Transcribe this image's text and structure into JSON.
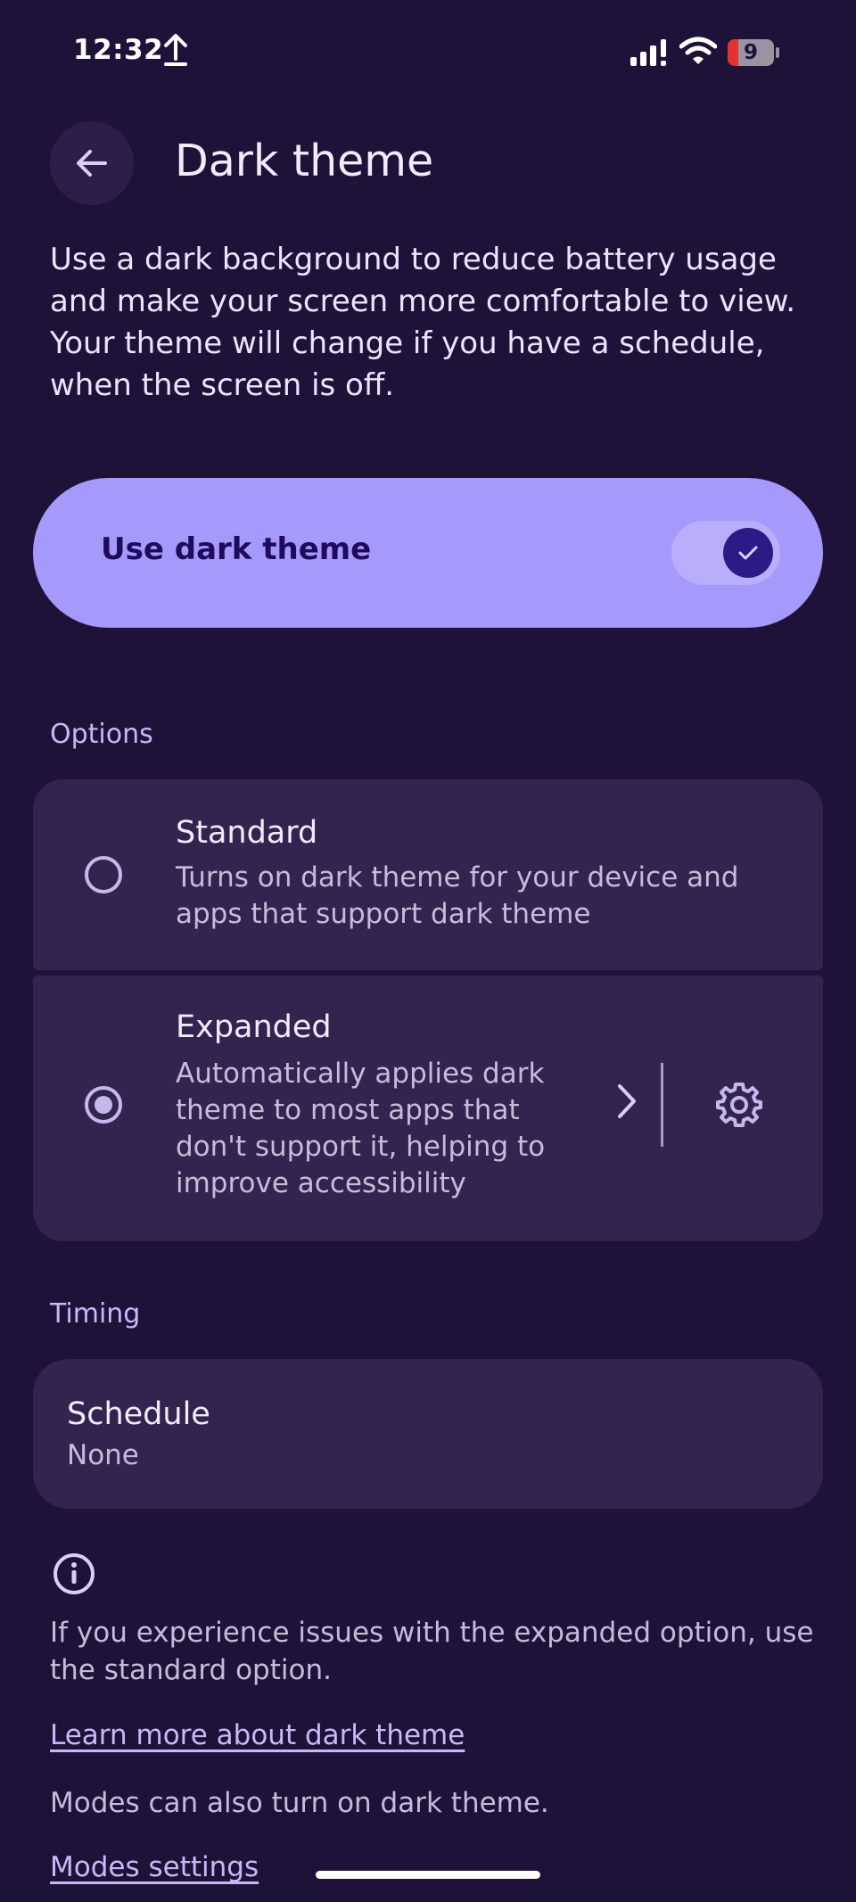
{
  "status_bar": {
    "time": "12:32",
    "battery_level": "9",
    "icons": [
      "upload-icon",
      "signal-icon",
      "wifi-icon",
      "battery-icon"
    ]
  },
  "header": {
    "title": "Dark theme",
    "back_icon": "arrow-left-icon"
  },
  "description": "Use a dark background to reduce battery usage and make your screen more comfortable to view. Your theme will change if you have a schedule, when the screen is off.",
  "main_toggle": {
    "label": "Use dark theme",
    "checked": true
  },
  "options": {
    "section_label": "Options",
    "items": [
      {
        "title": "Standard",
        "description": "Turns on dark theme for your device and apps that support dark theme",
        "selected": false
      },
      {
        "title": "Expanded",
        "description_lines": [
          "Automatically applies dark",
          "theme to most apps that",
          "don't support it, helping to",
          "improve accessibility"
        ],
        "selected": true
      }
    ]
  },
  "timing": {
    "section_label": "Timing",
    "schedule_title": "Schedule",
    "schedule_value": "None"
  },
  "footer": {
    "info_text": "If you experience issues with the expanded option, use the standard option.",
    "learn_more_link": "Learn more about dark theme",
    "modes_text": "Modes can also turn on dark theme.",
    "modes_link": "Modes settings"
  },
  "colors": {
    "background": "#1e1238",
    "card": "#33234f",
    "accent": "#a599fb",
    "accent_dark": "#2d1a86",
    "link": "#c7b9f8"
  }
}
